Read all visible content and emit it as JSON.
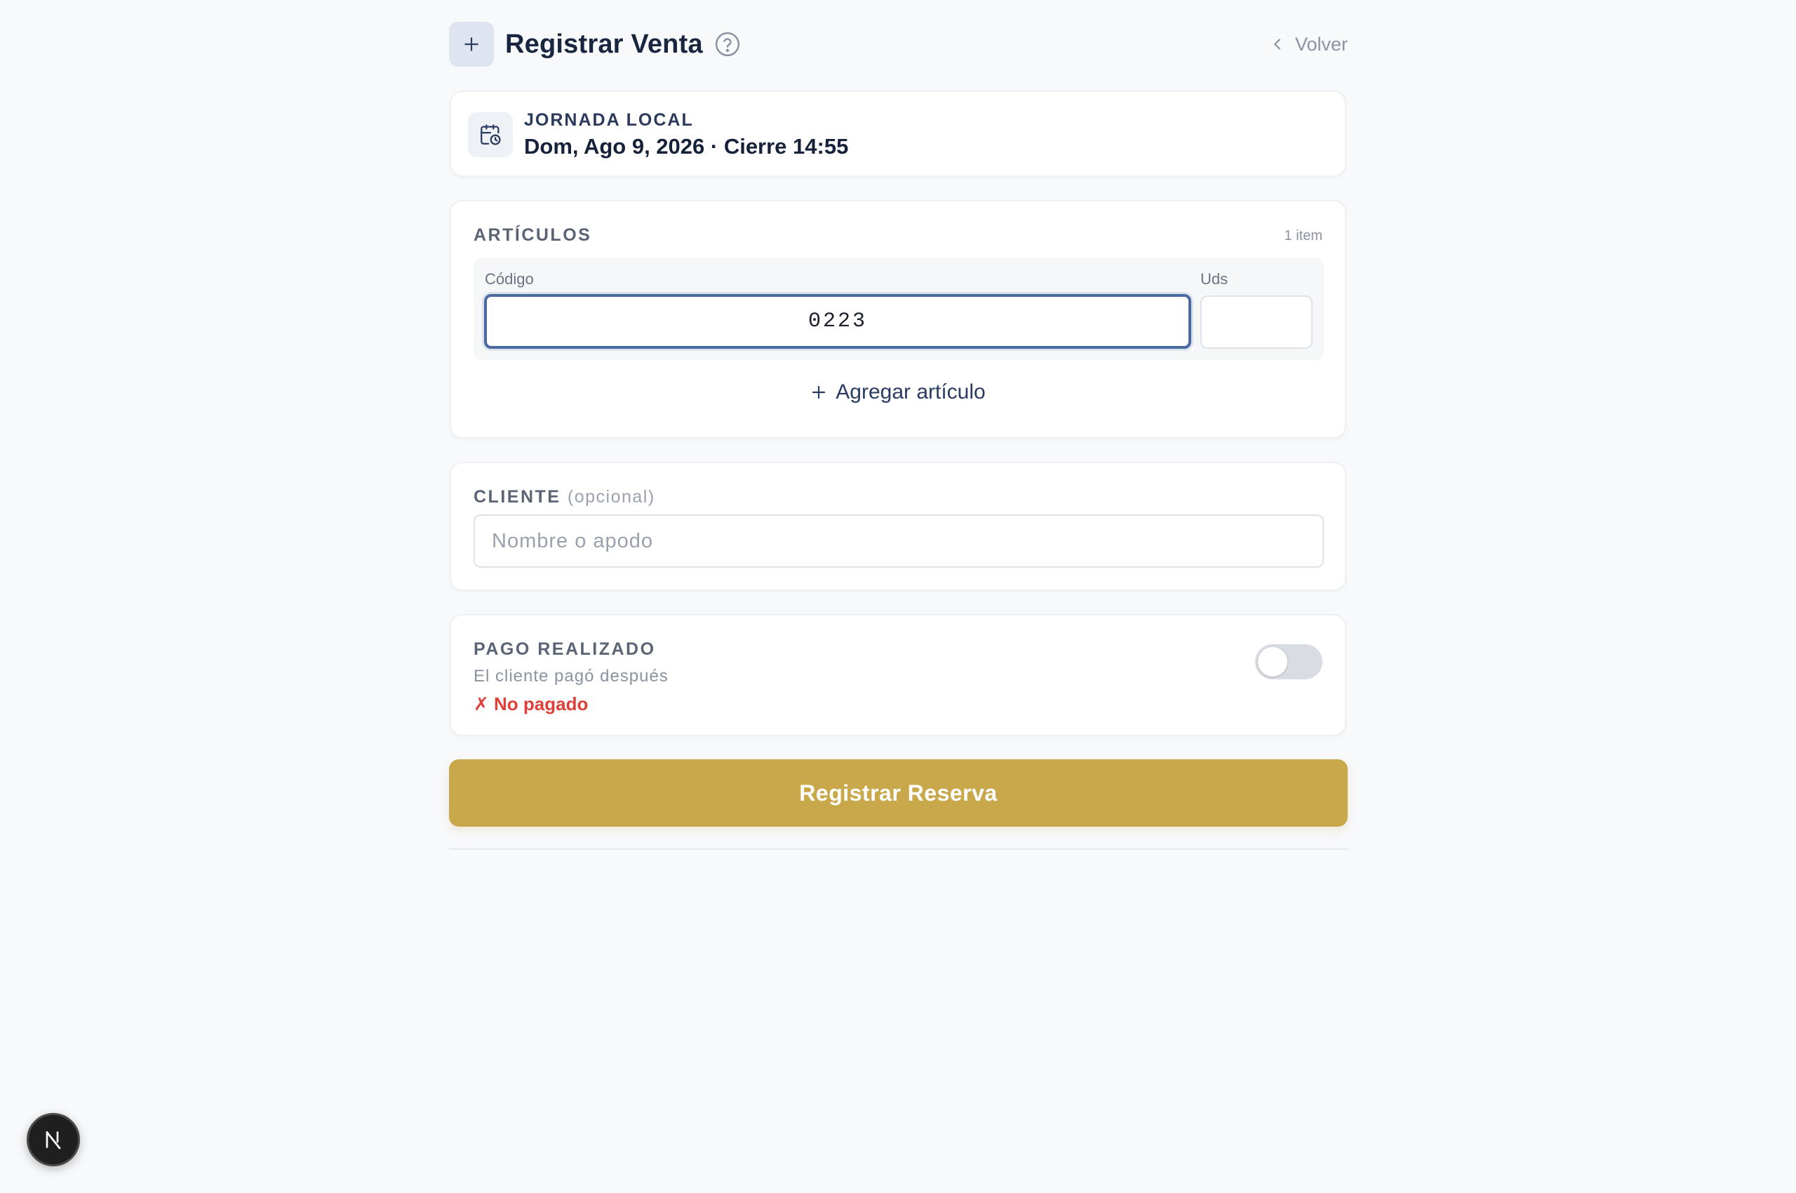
{
  "header": {
    "title": "Registrar Venta",
    "back_label": "Volver"
  },
  "jornada": {
    "label": "JORNADA LOCAL",
    "date": "Dom, Ago 9, 2026 · Cierre 14:55"
  },
  "articulos": {
    "label": "ARTÍCULOS",
    "count": "1 item",
    "codigo_caption": "Código",
    "uds_caption": "Uds",
    "codigo_value": "0223",
    "uds_value": "",
    "add_label": "Agregar artículo"
  },
  "cliente": {
    "label": "CLIENTE",
    "optional": "(opcional)",
    "placeholder": "Nombre o apodo",
    "value": ""
  },
  "pago": {
    "label": "PAGO REALIZADO",
    "subtitle": "El cliente pagó después",
    "status": "✗ No pagado",
    "toggle_on": false
  },
  "submit_label": "Registrar Reserva",
  "colors": {
    "accent_gold": "#c9a84b",
    "focus_blue": "#4a6aa0",
    "danger_red": "#e0403a",
    "background": "#f8f9fb"
  }
}
